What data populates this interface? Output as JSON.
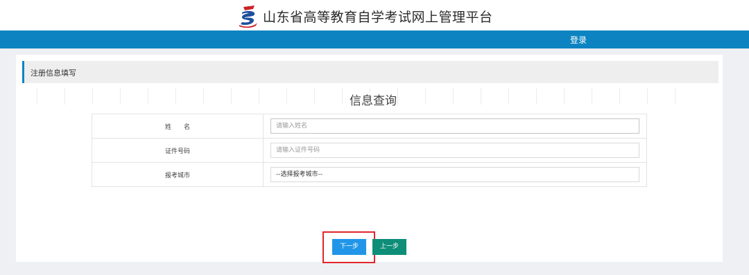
{
  "header": {
    "site_title": "山东省高等教育自学考试网上管理平台",
    "logo_icon": "education-logo-icon"
  },
  "nav": {
    "login_label": "登录"
  },
  "section": {
    "title": "注册信息填写"
  },
  "form": {
    "title": "信息查询",
    "rows": [
      {
        "label": "姓　　名",
        "placeholder": "请输入姓名",
        "value": ""
      },
      {
        "label": "证件号码",
        "placeholder": "请输入证件号码",
        "value": ""
      },
      {
        "label": "报考城市",
        "selected": "--选择报考城市--"
      }
    ]
  },
  "buttons": {
    "next_label": "下一步",
    "prev_label": "上一步"
  },
  "colors": {
    "nav_bar": "#0d84c1",
    "next_button": "#2196e8",
    "prev_button": "#0e8e78",
    "highlight": "#e0252b"
  }
}
